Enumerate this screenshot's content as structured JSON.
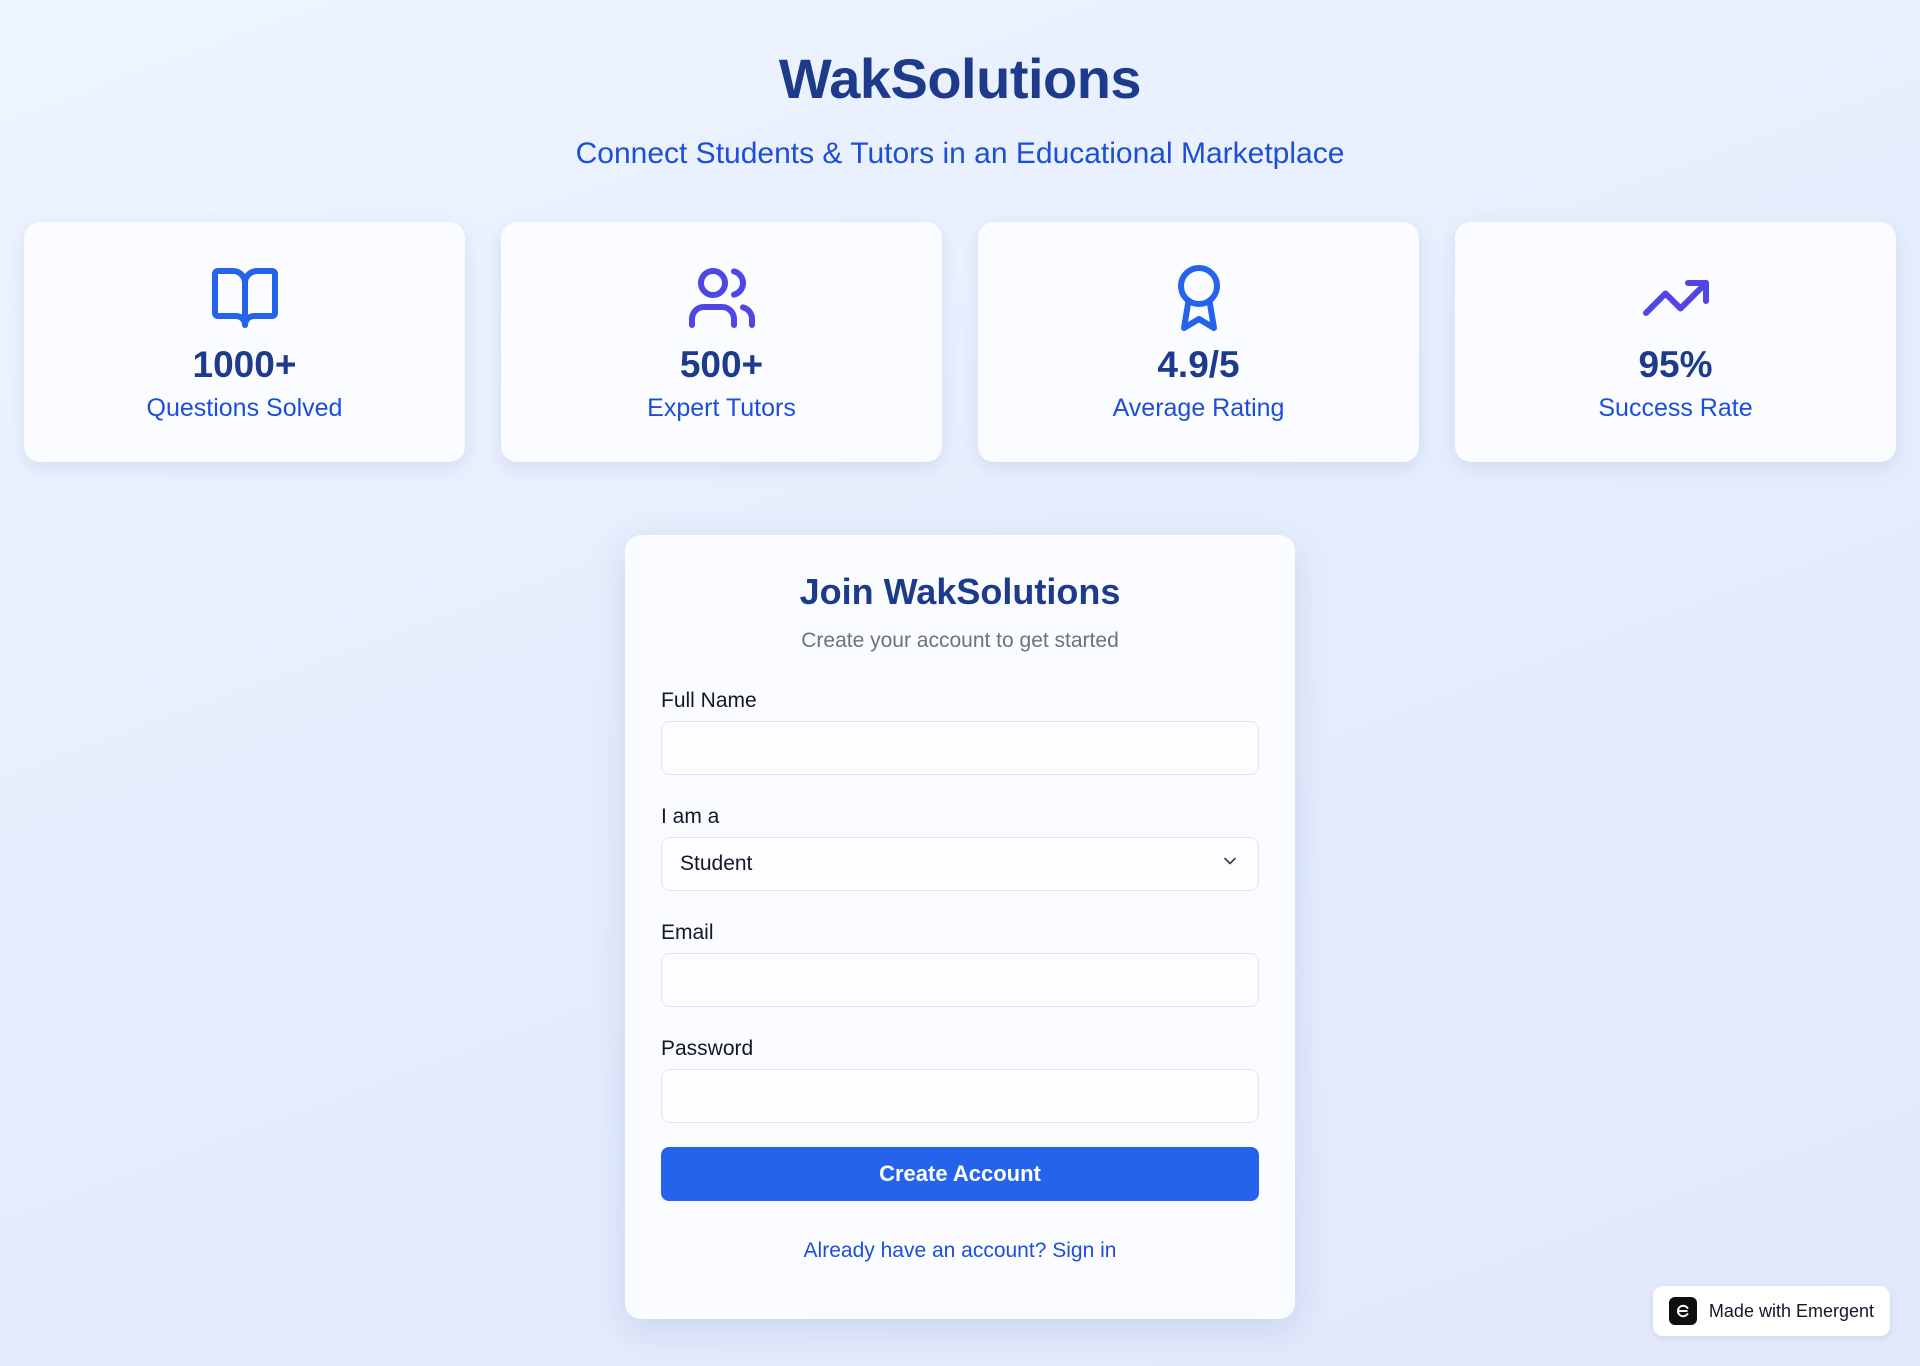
{
  "header": {
    "title": "WakSolutions",
    "tagline": "Connect Students & Tutors in an Educational Marketplace"
  },
  "stats": [
    {
      "icon": "book-open-icon",
      "value": "1000+",
      "label": "Questions Solved",
      "color": "#2563eb"
    },
    {
      "icon": "users-icon",
      "value": "500+",
      "label": "Expert Tutors",
      "color": "#4f46e5"
    },
    {
      "icon": "award-icon",
      "value": "4.9/5",
      "label": "Average Rating",
      "color": "#2563eb"
    },
    {
      "icon": "trending-up-icon",
      "value": "95%",
      "label": "Success Rate",
      "color": "#4f46e5"
    }
  ],
  "form": {
    "title": "Join WakSolutions",
    "subtitle": "Create your account to get started",
    "full_name_label": "Full Name",
    "full_name_value": "",
    "role_label": "I am a",
    "role_value": "Student",
    "email_label": "Email",
    "email_value": "",
    "password_label": "Password",
    "password_value": "",
    "submit_label": "Create Account",
    "signin_text": "Already have an account? Sign in"
  },
  "badge": {
    "text": "Made with Emergent"
  },
  "colors": {
    "primary": "#2563eb",
    "heading": "#1e3a8a",
    "accent": "#1d4ed8"
  }
}
